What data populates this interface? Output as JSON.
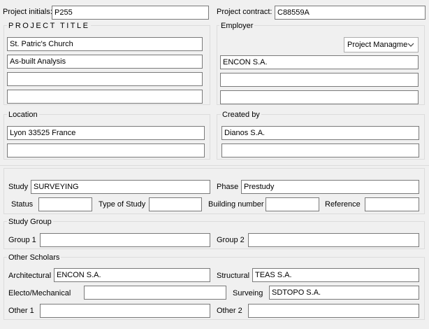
{
  "header": {
    "project_initials_label": "Project initials:",
    "project_initials_value": "P255",
    "project_contract_label": "Project contract:",
    "project_contract_value": "C88559A"
  },
  "project_title": {
    "label": "PROJECT TITLE",
    "lines": [
      "St. Patric's Church",
      "As-built Analysis",
      "",
      ""
    ]
  },
  "employer": {
    "label": "Employer",
    "dropdown_value": "Project Managme",
    "lines": [
      "ENCON S.A.",
      "",
      ""
    ]
  },
  "location": {
    "label": "Location",
    "lines": [
      "Lyon 33525 France",
      ""
    ]
  },
  "created_by": {
    "label": "Created by",
    "lines": [
      "Dianos S.A.",
      ""
    ]
  },
  "study": {
    "study_label": "Study",
    "study_value": "SURVEYING",
    "phase_label": "Phase",
    "phase_value": "Prestudy",
    "status_label": "Status",
    "status_value": "",
    "type_label": "Type of Study",
    "type_value": "",
    "building_label": "Building number",
    "building_value": "",
    "reference_label": "Reference",
    "reference_value": ""
  },
  "study_group": {
    "label": "Study Group",
    "group1_label": "Group 1",
    "group1_value": "",
    "group2_label": "Group 2",
    "group2_value": ""
  },
  "other_scholars": {
    "label": "Other Scholars",
    "architectural_label": "Architectural",
    "architectural_value": "ENCON S.A.",
    "structural_label": "Structural",
    "structural_value": "TEAS S.A.",
    "electro_label": "Electo/Mechanical",
    "electro_value": "",
    "surveing_label": "Surveing",
    "surveing_value": "SDTOPO S.A.",
    "other1_label": "Other 1",
    "other1_value": "",
    "other2_label": "Other 2",
    "other2_value": ""
  },
  "icons": {
    "dropdown_chevron": "chevron-down-icon"
  }
}
